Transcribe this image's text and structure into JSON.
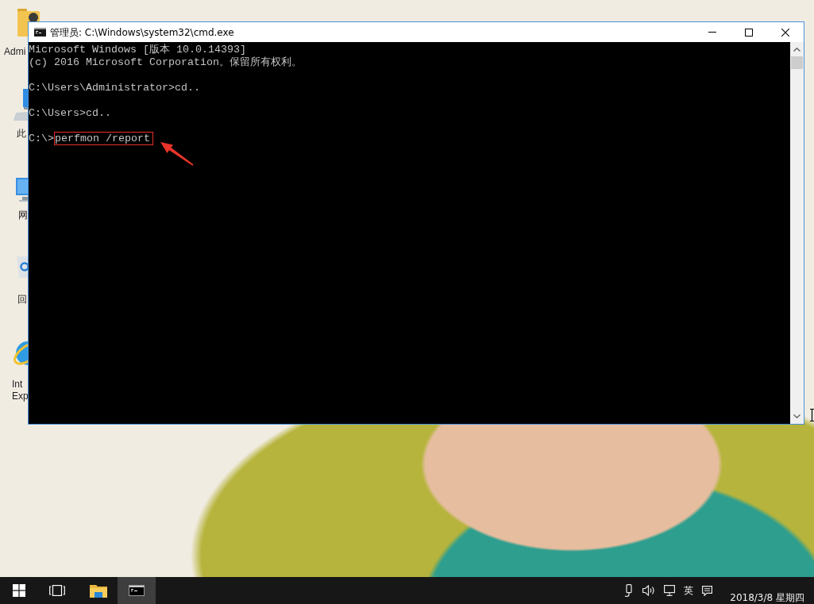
{
  "desktop": {
    "icons": [
      {
        "kind": "folder",
        "label_lines": [
          "Admi"
        ]
      },
      {
        "kind": "computer",
        "label_lines": [
          "此"
        ]
      },
      {
        "kind": "network",
        "label_lines": [
          "网"
        ]
      },
      {
        "kind": "recycle-bin",
        "label_lines": [
          "回"
        ]
      },
      {
        "kind": "browser",
        "label_lines": [
          "Int",
          "Exp"
        ]
      }
    ]
  },
  "window": {
    "title": "管理员: C:\\Windows\\system32\\cmd.exe"
  },
  "console": {
    "blocks": [
      [
        {
          "kind": "output",
          "text": "Microsoft Windows [版本 10.0.14393]"
        },
        {
          "kind": "output",
          "text": "(c) 2016 Microsoft Corporation。保留所有权利。"
        }
      ],
      [
        {
          "kind": "command",
          "prompt": "C:\\Users\\Administrator>",
          "command": "cd..",
          "highlighted": false
        }
      ],
      [
        {
          "kind": "command",
          "prompt": "C:\\Users>",
          "command": "cd..",
          "highlighted": false
        }
      ],
      [
        {
          "kind": "command",
          "prompt": "C:\\>",
          "command": "perfmon /report",
          "highlighted": true
        }
      ]
    ]
  },
  "taskbar": {
    "buttons": [
      {
        "kind": "start"
      },
      {
        "kind": "task-view"
      }
    ],
    "apps": [
      {
        "kind": "file-explorer",
        "active": false
      },
      {
        "kind": "console",
        "active": true
      }
    ],
    "tray": [
      {
        "kind": "usb"
      },
      {
        "kind": "volume"
      },
      {
        "kind": "network"
      },
      {
        "kind": "ime",
        "text": "英"
      },
      {
        "kind": "notification"
      }
    ],
    "date": "2018/3/8 星期四"
  }
}
